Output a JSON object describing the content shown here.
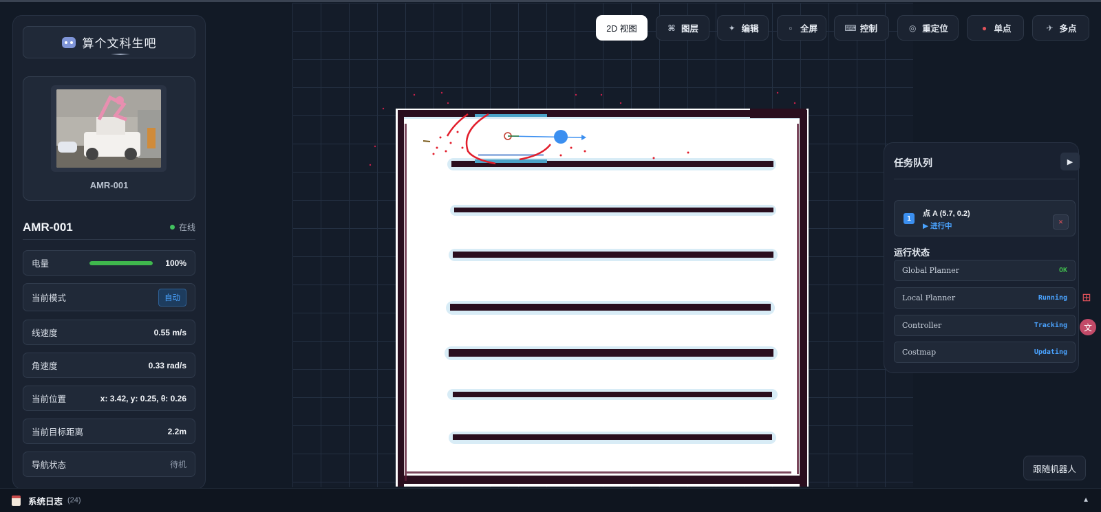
{
  "brand": {
    "title": "算个文科生吧",
    "icon": "robot-icon"
  },
  "robot": {
    "photo_caption": "AMR-001",
    "name": "AMR-001",
    "status": "在线",
    "status_color": "#42c15f"
  },
  "info": {
    "battery": {
      "label": "电量",
      "value": "100%",
      "level": 1.0
    },
    "mode": {
      "label": "当前模式",
      "value": "自动"
    },
    "linear_speed": {
      "label": "线速度",
      "value": "0.55 m/s"
    },
    "angular_speed": {
      "label": "角速度",
      "value": "0.33 rad/s"
    },
    "position": {
      "label": "当前位置",
      "value": "x: 3.42, y: 0.25, θ: 0.26"
    },
    "goal_distance": {
      "label": "当前目标距离",
      "value": "2.2m"
    },
    "nav_status": {
      "label": "导航状态",
      "value": "待机"
    }
  },
  "toolbar": {
    "view2d": "2D 视图",
    "layers": "图层",
    "edit": "编辑",
    "fullscreen": "全屏",
    "control": "控制",
    "relocate": "重定位",
    "single_point": "单点",
    "multi_point": "多点"
  },
  "task_queue": {
    "title": "任务队列",
    "items": [
      {
        "index": "1",
        "name": "点 A (5.7, 0.2)",
        "state": "▶ 进行中"
      }
    ]
  },
  "run_status": {
    "title": "运行状态",
    "rows": [
      {
        "name": "Global Planner",
        "value": "OK",
        "color": "#3fb84d"
      },
      {
        "name": "Local Planner",
        "value": "Running",
        "color": "#4aa3ff"
      },
      {
        "name": "Controller",
        "value": "Tracking",
        "color": "#4aa3ff"
      },
      {
        "name": "Costmap",
        "value": "Updating",
        "color": "#4aa3ff"
      }
    ]
  },
  "follow_robot": "跟随机器人",
  "log": {
    "label": "系统日志",
    "count": "(24)"
  },
  "colors": {
    "accent": "#4aa3ff",
    "online": "#42c15f",
    "danger": "#e0525a",
    "wall": "#2a0e1e"
  }
}
